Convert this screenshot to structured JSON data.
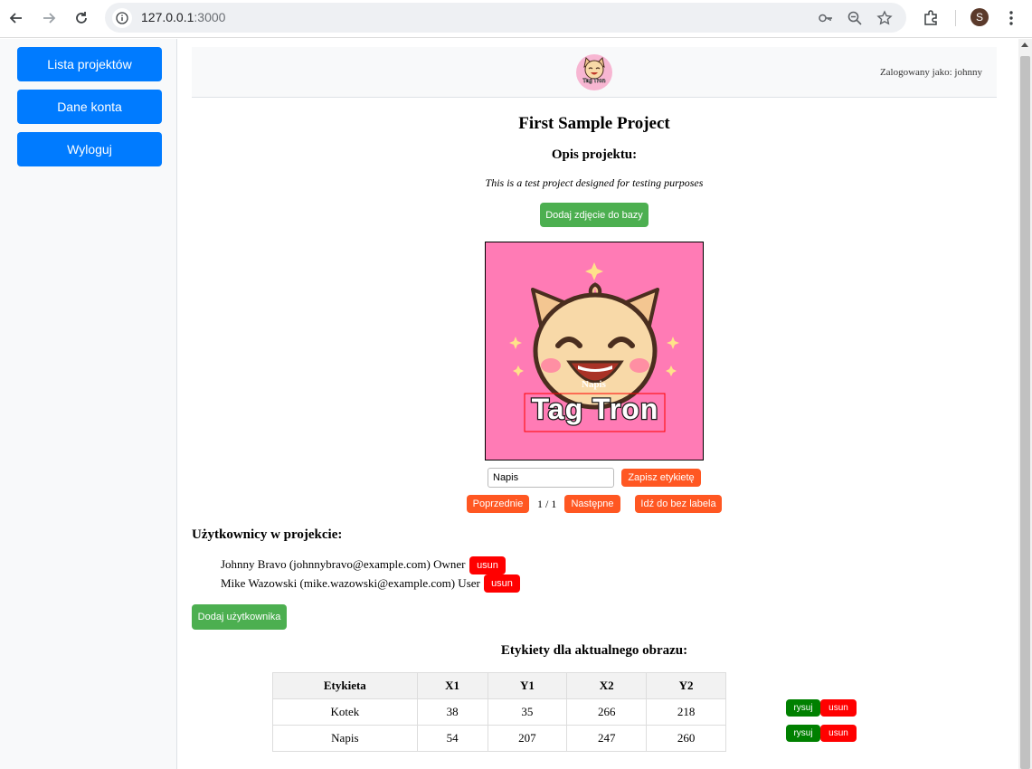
{
  "browser": {
    "url_host": "127.0.0.1",
    "url_port": ":3000",
    "profile_initial": "S"
  },
  "sidebar": {
    "items": [
      {
        "label": "Lista projektów"
      },
      {
        "label": "Dane konta"
      },
      {
        "label": "Wyloguj"
      }
    ]
  },
  "header": {
    "logged_in": "Zalogowany jako: johnny",
    "logo_text": "Tag Tron"
  },
  "project": {
    "title": "First Sample Project",
    "description_heading": "Opis projektu:",
    "description": "This is a test project designed for testing purposes",
    "add_image_label": "Dodaj zdjęcie do bazy"
  },
  "image": {
    "label_overlay": "Napis",
    "logo_text": "Tag Tron"
  },
  "label_editor": {
    "input_value": "Napis",
    "save_label": "Zapisz etykietę",
    "prev_label": "Poprzednie",
    "page_indicator": "1 / 1",
    "next_label": "Następne",
    "goto_unlabeled_label": "Idź do bez labela"
  },
  "users": {
    "heading": "Użytkownicy w projekcie:",
    "list": [
      {
        "text": "Johnny Bravo (johnnybravo@example.com) Owner",
        "remove_label": "usun"
      },
      {
        "text": "Mike Wazowski (mike.wazowski@example.com) User",
        "remove_label": "usun"
      }
    ],
    "add_label": "Dodaj użytkownika"
  },
  "labels_table": {
    "heading": "Etykiety dla aktualnego obrazu:",
    "columns": [
      "Etykieta",
      "X1",
      "Y1",
      "X2",
      "Y2"
    ],
    "rows": [
      {
        "cells": [
          "Kotek",
          "38",
          "35",
          "266",
          "218"
        ],
        "draw_label": "rysuj",
        "remove_label": "usun"
      },
      {
        "cells": [
          "Napis",
          "54",
          "207",
          "247",
          "260"
        ],
        "draw_label": "rysuj",
        "remove_label": "usun"
      }
    ]
  },
  "colors": {
    "primary": "#007bff",
    "success": "#4caf50",
    "warning": "#ff5722",
    "danger": "#ff0000",
    "draw": "#008000",
    "image_bg": "#ff7bb5"
  }
}
